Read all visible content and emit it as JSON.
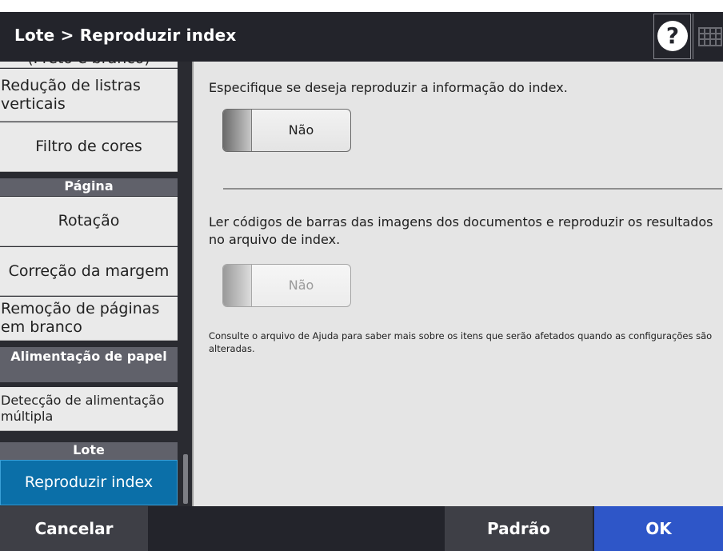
{
  "header": {
    "title": "Lote > Reproduzir index"
  },
  "help_button": {
    "glyph": "?"
  },
  "sidebar": {
    "partial_top": "(Preto e branco)",
    "items": [
      {
        "label": "Redução de listras verticais"
      },
      {
        "label": "Filtro de cores"
      },
      {
        "section": "Página"
      },
      {
        "label": "Rotação"
      },
      {
        "label": "Correção da margem"
      },
      {
        "label": "Remoção de páginas em branco"
      },
      {
        "section": "Alimentação de papel"
      },
      {
        "label": "Detecção de alimentação múltipla"
      },
      {
        "section": "Lote"
      },
      {
        "label": "Reproduzir index",
        "selected": true
      }
    ]
  },
  "main": {
    "desc1": "Especifique se deseja reproduzir a informação do index.",
    "toggle1": {
      "label": "Não",
      "enabled": true
    },
    "desc2": "Ler códigos de barras das imagens dos documentos e reproduzir os resultados no arquivo de index.",
    "toggle2": {
      "label": "Não",
      "enabled": false
    },
    "note": "Consulte o arquivo de Ajuda para saber mais sobre os itens que serão afetados quando as configurações são alteradas."
  },
  "footer": {
    "cancel_label": "Cancelar",
    "default_label": "Padrão",
    "ok_label": "OK"
  },
  "colors": {
    "header_bg": "#23242b",
    "selected_bg": "#0b6fa8",
    "ok_bg": "#2e56c8",
    "content_bg": "#e5e5e5"
  }
}
